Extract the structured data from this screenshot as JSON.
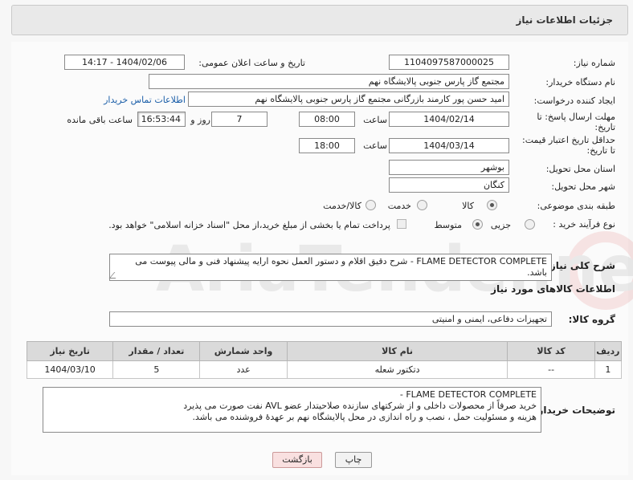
{
  "header": {
    "title": "جزئیات اطلاعات نیاز"
  },
  "form": {
    "need_number_label": "شماره نیاز:",
    "need_number": "1104097587000025",
    "announce_label": "تاریخ و ساعت اعلان عمومی:",
    "announce_value": "1404/02/06 - 14:17",
    "buyer_org_label": "نام دستگاه خریدار:",
    "buyer_org": "مجتمع گاز پارس جنوبی  پالایشگاه نهم",
    "creator_label": "ایجاد کننده درخواست:",
    "creator": "امید حسن پور کارمند بازرگانی مجتمع گاز پارس جنوبی  پالایشگاه نهم",
    "contact_link": "اطلاعات تماس خریدار",
    "deadline_label_1": "مهلت ارسال پاسخ: تا",
    "deadline_label_2": "تاریخ:",
    "deadline_date": "1404/02/14",
    "hour_label": "ساعت",
    "deadline_time": "08:00",
    "days_value": "7",
    "days_label": "روز و",
    "remaining_time": "16:53:44",
    "remaining_label": "ساعت باقی مانده",
    "validity_label_1": "حداقل تاریخ اعتبار قیمت:",
    "validity_label_2": "تا تاریخ:",
    "validity_date": "1404/03/14",
    "validity_hour_label": "ساعت",
    "validity_time": "18:00",
    "province_label": "استان محل تحویل:",
    "province": "بوشهر",
    "city_label": "شهر محل تحویل:",
    "city": "کنگان",
    "category_label": "طبقه بندی موضوعی:",
    "category_options": [
      "کالا",
      "خدمت",
      "کالا/خدمت"
    ],
    "category_selected": "کالا",
    "process_label": "نوع فرآیند خرید :",
    "process_options": [
      "جزیی",
      "متوسط"
    ],
    "process_selected": "متوسط",
    "payment_note": "پرداخت تمام یا بخشی از مبلغ خرید،از محل \"اسناد خزانه اسلامی\" خواهد بود.",
    "summary_label": "شرح کلی نیاز:",
    "summary": "FLAME DETECTOR COMPLETE - شرح دقیق اقلام و دستور العمل نحوه ارایه پیشنهاد فنی و مالی پیوست می باشد."
  },
  "goods": {
    "section_title": "اطلاعات کالاهای مورد نیاز",
    "group_label": "گروه کالا:",
    "group_value": "تجهیزات دفاعی، ایمنی و امنیتی",
    "columns": [
      "ردیف",
      "کد کالا",
      "نام کالا",
      "واحد شمارش",
      "تعداد / مقدار",
      "تاریخ نیاز"
    ],
    "rows": [
      [
        "1",
        "--",
        "دتکتور شعله",
        "عدد",
        "5",
        "1404/03/10"
      ]
    ]
  },
  "buyer_notes": {
    "label": "توضیحات خریدار:",
    "lines": [
      "FLAME DETECTOR COMPLETE -",
      "خرید صرفاً از محصولات داخلی و از شرکتهای سازنده صلاحیتدار عضو AVL نفت صورت می پذیرد",
      "هزینه و مسئولیت حمل ، نصب و راه اندازی در محل پالایشگاه نهم بر عهدهٔ فروشنده می باشد."
    ]
  },
  "buttons": {
    "print": "چاپ",
    "back": "بازگشت"
  },
  "colors": {
    "link": "#1a5ea8",
    "back_button_bg": "#f9e0e0"
  }
}
